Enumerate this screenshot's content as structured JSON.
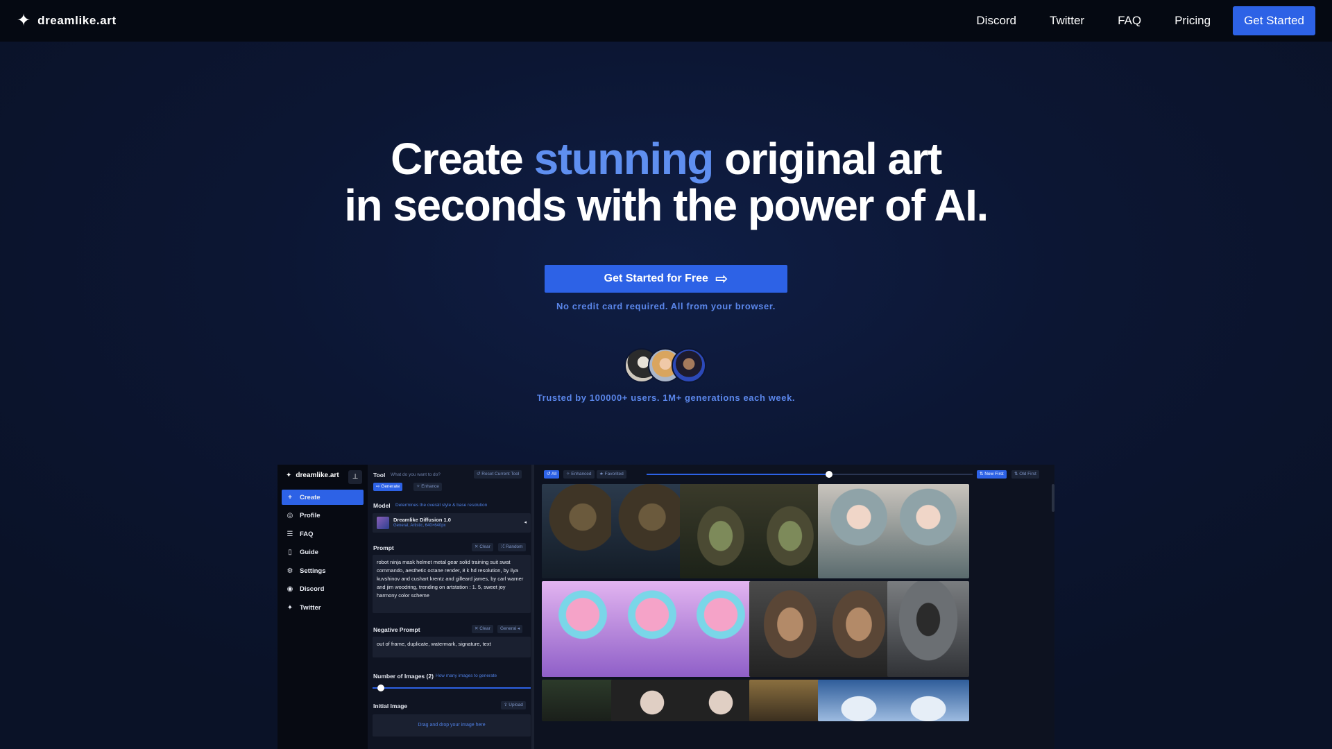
{
  "nav": {
    "brand": "dreamlike.art",
    "links": [
      "Discord",
      "Twitter",
      "FAQ",
      "Pricing"
    ],
    "cta": "Get Started"
  },
  "hero": {
    "title_part1": "Create",
    "title_accent": "stunning",
    "title_part2": "original art",
    "title_line2": "in seconds with the power of AI.",
    "cta": "Get Started for Free",
    "note": "No credit card required. All from your browser.",
    "trust": "Trusted by 100000+ users. 1M+ generations each week."
  },
  "colors": {
    "accent": "#5f8ff0",
    "button": "#2d62e6",
    "background": "#0b1329",
    "nav": "#050912"
  },
  "preview": {
    "brand": "dreamlike.art",
    "sidebar": [
      {
        "label": "Create",
        "icon": "plus-icon",
        "glyph": "+"
      },
      {
        "label": "Profile",
        "icon": "profile-icon",
        "glyph": "◎"
      },
      {
        "label": "FAQ",
        "icon": "list-icon",
        "glyph": "☰"
      },
      {
        "label": "Guide",
        "icon": "book-icon",
        "glyph": "▯"
      },
      {
        "label": "Settings",
        "icon": "gear-icon",
        "glyph": "⚙"
      },
      {
        "label": "Discord",
        "icon": "discord-icon",
        "glyph": "◉"
      },
      {
        "label": "Twitter",
        "icon": "twitter-icon",
        "glyph": "✦"
      }
    ],
    "tool": {
      "label": "Tool",
      "hint": "What do you want to do?",
      "reset": "Reset Current Tool",
      "generate": "Generate",
      "enhance": "Enhance"
    },
    "model": {
      "label": "Model",
      "hint": "Determines the overall style & base resolution",
      "name": "Dreamlike Diffusion 1.0",
      "desc": "General, Artistic, 640×640px"
    },
    "prompt": {
      "label": "Prompt",
      "clear": "Clear",
      "random": "Random",
      "text": "robot ninja mask helmet metal gear solid training suit swat commando, aesthetic octane render, 8 k hd resolution, by ilya kuvshinov and cushart krentz and gilleard james, by carl warner and jim woodring, trending on artstation : 1. 5, sweet joy harmony color scheme"
    },
    "negative": {
      "label": "Negative Prompt",
      "clear": "Clear",
      "general": "General",
      "text": "out of frame, duplicate, watermark, signature, text"
    },
    "num_images": {
      "label": "Number of Images (2)",
      "hint": "How many images to generate",
      "value": 2
    },
    "initial_image": {
      "label": "Initial Image",
      "upload": "Upload",
      "drop": "Drag and drop your image here"
    },
    "gallery": {
      "filters": [
        "All",
        "Enhanced",
        "Favorited"
      ],
      "sort": [
        "New First",
        "Old First"
      ],
      "tiles": [
        "owl",
        "owl",
        "yoda",
        "yoda",
        "anime-girl",
        "anime-girl",
        "ice-cream",
        "ice-cream",
        "ice-cream",
        "warrior",
        "warrior",
        "dark-figure",
        "forest",
        "portrait",
        "portrait",
        "statue",
        "clouds",
        "clouds"
      ]
    }
  }
}
